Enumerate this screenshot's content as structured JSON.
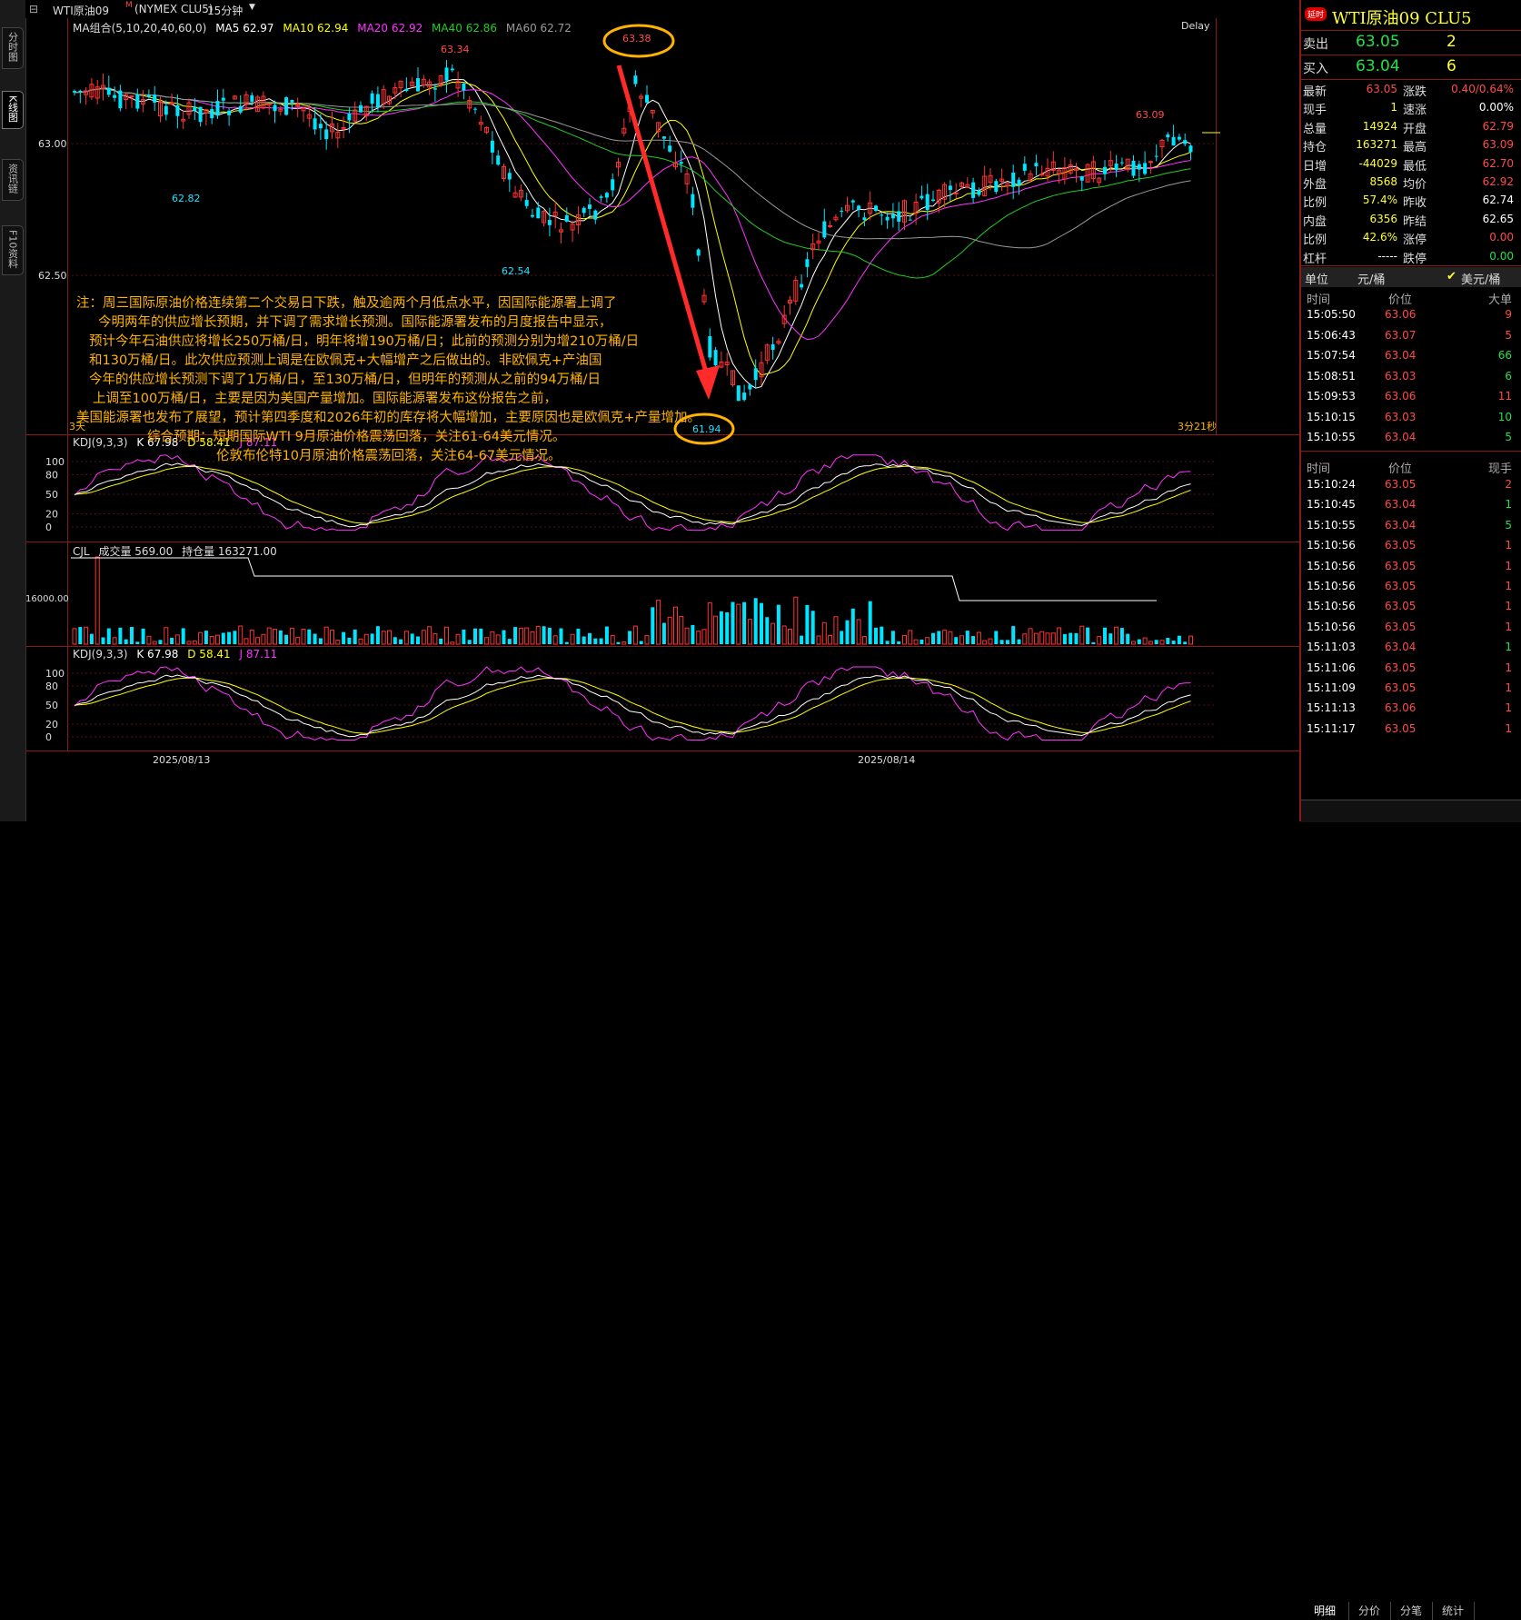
{
  "left_tabs": [
    {
      "label": "分时图"
    },
    {
      "label": "K线图"
    },
    {
      "label": "资讯链"
    },
    {
      "label": "F10资料"
    }
  ],
  "header": {
    "title": "WTI原油09",
    "title_sup": "M",
    "code": "(NYMEX CLU5)",
    "period": "15分钟"
  },
  "ma_line": {
    "label": "MA组合(5,10,20,40,60,0)",
    "ma5": "MA5 62.97",
    "ma10": "MA10 62.94",
    "ma20": "MA20 62.92",
    "ma40": "MA40 62.86",
    "ma60": "MA60 62.72",
    "delay": "Delay"
  },
  "colors": {
    "ma5": "#ffffff",
    "ma10": "#ffff00",
    "ma20": "#ff33ff",
    "ma40": "#22cc22",
    "ma60": "#999999",
    "up": "#ff3333",
    "down": "#00e5ff",
    "annotation": "#ffb300",
    "arrow": "#ff2a2a",
    "circle": "#ffb300"
  },
  "price_axis": [
    "63.00",
    "62.50"
  ],
  "price_marks": {
    "h1": "63.34",
    "h2": "63.38",
    "h3": "63.09",
    "l1": "62.82",
    "l2": "62.54",
    "l3": "61.94"
  },
  "chart_footer": {
    "left": "3天",
    "right": "3分21秒"
  },
  "note_lines": [
    "注：周三国际原油价格连续第二个交易日下跌，触及逾两个月低点水平，因国际能源署上调了",
    "今明两年的供应增长预期，并下调了需求增长预测。国际能源署发布的月度报告中显示，",
    "预计今年石油供应将增长250万桶/日，明年将增190万桶/日；此前的预测分别为增210万桶/日",
    "和130万桶/日。此次供应预测上调是在欧佩克+大幅增产之后做出的。非欧佩克+产油国",
    "今年的供应增长预测下调了1万桶/日，至130万桶/日，但明年的预测从之前的94万桶/日",
    "上调至100万桶/日，主要是因为美国产量增加。国际能源署发布这份报告之前，",
    "美国能源署也发布了展望，预计第四季度和2026年初的库存将大幅增加，主要原因也是欧佩克+产量增加。",
    "综合预期：短期国际WTI 9月原油价格震荡回落，关注61-64美元情况。",
    "伦敦布伦特10月原油价格震荡回落，关注64-67美元情况。"
  ],
  "kdj1": {
    "label": "KDJ(9,3,3)",
    "k": "K 67.98",
    "d": "D 58.41",
    "j": "J 87.11",
    "axis": [
      "100",
      "80",
      "50",
      "20",
      "0"
    ]
  },
  "vol": {
    "label": "CJL",
    "cjl": "成交量 569.00",
    "oi": "持仓量 163271.00",
    "axis": "16000.00"
  },
  "kdj2": {
    "label": "KDJ(9,3,3)",
    "k": "K 67.98",
    "d": "D 58.41",
    "j": "J 87.11",
    "axis": [
      "100",
      "80",
      "50",
      "20",
      "0"
    ]
  },
  "dates": [
    "2025/08/13",
    "2025/08/14"
  ],
  "right_panel": {
    "badge": "延时",
    "title": "WTI原油09  CLU5",
    "ask": {
      "label": "卖出",
      "price": "63.05",
      "qty": "2"
    },
    "bid": {
      "label": "买入",
      "price": "63.04",
      "qty": "6"
    },
    "stats": [
      {
        "l1": "最新",
        "v1": "63.05",
        "c1": "red",
        "l2": "涨跌",
        "v2": "0.40/0.64%",
        "c2": "red"
      },
      {
        "l1": "现手",
        "v1": "1",
        "c1": "yel",
        "l2": "速涨",
        "v2": "0.00%",
        "c2": "wht"
      },
      {
        "l1": "总量",
        "v1": "14924",
        "c1": "yel",
        "l2": "开盘",
        "v2": "62.79",
        "c2": "red"
      },
      {
        "l1": "持仓",
        "v1": "163271",
        "c1": "yel",
        "l2": "最高",
        "v2": "63.09",
        "c2": "red"
      },
      {
        "l1": "日增",
        "v1": "-44029",
        "c1": "yel",
        "l2": "最低",
        "v2": "62.70",
        "c2": "red"
      },
      {
        "l1": "外盘",
        "v1": "8568",
        "c1": "yel",
        "l2": "均价",
        "v2": "62.92",
        "c2": "red"
      },
      {
        "l1": "比例",
        "v1": "57.4%",
        "c1": "yel",
        "l2": "昨收",
        "v2": "62.74",
        "c2": "wht"
      },
      {
        "l1": "内盘",
        "v1": "6356",
        "c1": "yel",
        "l2": "昨结",
        "v2": "62.65",
        "c2": "wht"
      },
      {
        "l1": "比例",
        "v1": "42.6%",
        "c1": "yel",
        "l2": "涨停",
        "v2": "0.00",
        "c2": "red"
      },
      {
        "l1": "杠杆",
        "v1": "-----",
        "c1": "wht",
        "l2": "跌停",
        "v2": "0.00",
        "c2": "grn"
      }
    ],
    "unit": {
      "label": "单位",
      "opt1": "元/桶",
      "opt2": "美元/桶"
    },
    "big_header": {
      "time": "时间",
      "price": "价位",
      "qty": "大单"
    },
    "big_trades": [
      {
        "t": "15:05:50",
        "p": "63.06",
        "q": "9",
        "c": "red"
      },
      {
        "t": "15:06:43",
        "p": "63.07",
        "q": "5",
        "c": "red"
      },
      {
        "t": "15:07:54",
        "p": "63.04",
        "q": "66",
        "c": "grn"
      },
      {
        "t": "15:08:51",
        "p": "63.03",
        "q": "6",
        "c": "grn"
      },
      {
        "t": "15:09:53",
        "p": "63.06",
        "q": "11",
        "c": "red"
      },
      {
        "t": "15:10:15",
        "p": "63.03",
        "q": "10",
        "c": "grn"
      },
      {
        "t": "15:10:55",
        "p": "63.04",
        "q": "5",
        "c": "grn"
      }
    ],
    "tick_header": {
      "time": "时间",
      "price": "价位",
      "qty": "现手"
    },
    "ticks": [
      {
        "t": "15:10:24",
        "p": "63.05",
        "q": "2",
        "c": "red"
      },
      {
        "t": "15:10:45",
        "p": "63.04",
        "q": "1",
        "c": "grn"
      },
      {
        "t": "15:10:55",
        "p": "63.04",
        "q": "5",
        "c": "grn"
      },
      {
        "t": "15:10:56",
        "p": "63.05",
        "q": "1",
        "c": "red"
      },
      {
        "t": "15:10:56",
        "p": "63.05",
        "q": "1",
        "c": "red"
      },
      {
        "t": "15:10:56",
        "p": "63.05",
        "q": "1",
        "c": "red"
      },
      {
        "t": "15:10:56",
        "p": "63.05",
        "q": "1",
        "c": "red"
      },
      {
        "t": "15:10:56",
        "p": "63.05",
        "q": "1",
        "c": "red"
      },
      {
        "t": "15:11:03",
        "p": "63.04",
        "q": "1",
        "c": "grn"
      },
      {
        "t": "15:11:06",
        "p": "63.05",
        "q": "1",
        "c": "red"
      },
      {
        "t": "15:11:09",
        "p": "63.05",
        "q": "1",
        "c": "red"
      },
      {
        "t": "15:11:13",
        "p": "63.06",
        "q": "1",
        "c": "red"
      },
      {
        "t": "15:11:17",
        "p": "63.05",
        "q": "1",
        "c": "red"
      }
    ],
    "bottom_tabs": [
      "明细",
      "分价",
      "分笔",
      "统计"
    ]
  }
}
